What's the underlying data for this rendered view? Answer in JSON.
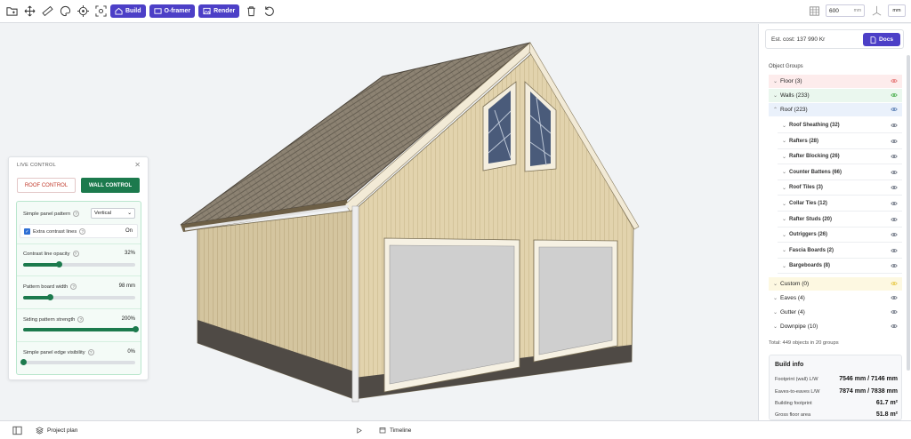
{
  "toolbar": {
    "build": "Build",
    "oframer": "O-framer",
    "render": "Render",
    "size_value": "600",
    "size_unit": "mm",
    "unit": "mm"
  },
  "live_control": {
    "title": "LIVE CONTROL",
    "roof_control": "ROOF CONTROL",
    "wall_control": "WALL CONTROL",
    "simple_panel_pattern": "Simple panel pattern",
    "pattern_value": "Vertical",
    "extra_contrast": "Extra contrast lines",
    "extra_contrast_value": "On",
    "contrast_opacity": "Contrast line opacity",
    "contrast_opacity_value": "32%",
    "contrast_opacity_level": 0.32,
    "board_width": "Pattern board width",
    "board_width_value": "98 mm",
    "board_width_level": 0.24,
    "siding_strength": "Siding pattern strength",
    "siding_strength_value": "200%",
    "siding_strength_level": 1.0,
    "edge_visibility": "Simple panel edge visibility",
    "edge_visibility_value": "0%",
    "edge_visibility_level": 0.0
  },
  "sidebar": {
    "cost": "Est. cost: 137 990 Kr",
    "docs": "Docs",
    "object_groups_title": "Object Groups",
    "groups": [
      {
        "label": "Floor (3)",
        "bg": "#fdecec",
        "eye": "#e57373"
      },
      {
        "label": "Walls (233)",
        "bg": "#eaf7ee",
        "eye": "#4caf50"
      },
      {
        "label": "Roof (223)",
        "bg": "#eaf1fb",
        "eye": "#5b7fb5"
      }
    ],
    "roof_children": [
      "Roof Sheathing (32)",
      "Rafters (28)",
      "Rafter Blocking (26)",
      "Counter Battens (66)",
      "Roof Tiles (3)",
      "Collar Ties (12)",
      "Rafter Studs (20)",
      "Outriggers (26)",
      "Fascia Boards (2)",
      "Bargeboards (8)"
    ],
    "more_groups": [
      {
        "label": "Custom (0)",
        "bg": "#fdf8e1",
        "eye": "#e8c94a"
      },
      {
        "label": "Eaves (4)",
        "bg": "#ffffff",
        "eye": "#6b7280"
      },
      {
        "label": "Gutter (4)",
        "bg": "#ffffff",
        "eye": "#6b7280"
      },
      {
        "label": "Downpipe (10)",
        "bg": "#ffffff",
        "eye": "#6b7280"
      }
    ],
    "total": "Total: 449 objects in 20 groups",
    "build_info": {
      "title": "Build info",
      "rows": [
        {
          "label": "Footprint (wall) L/W",
          "value": "7546 mm / 7146 mm"
        },
        {
          "label": "Eaves-to-eaves L/W",
          "value": "7874 mm / 7838 mm"
        },
        {
          "label": "Building footprint",
          "value": "61.7 m²"
        },
        {
          "label": "Gross floor area",
          "value": "51.8 m²"
        }
      ]
    }
  },
  "bottom": {
    "project_plan": "Project plan",
    "timeline": "Timeline"
  },
  "colors": {
    "accent": "#4c3fc7",
    "wall_green": "#1c7a4d"
  }
}
